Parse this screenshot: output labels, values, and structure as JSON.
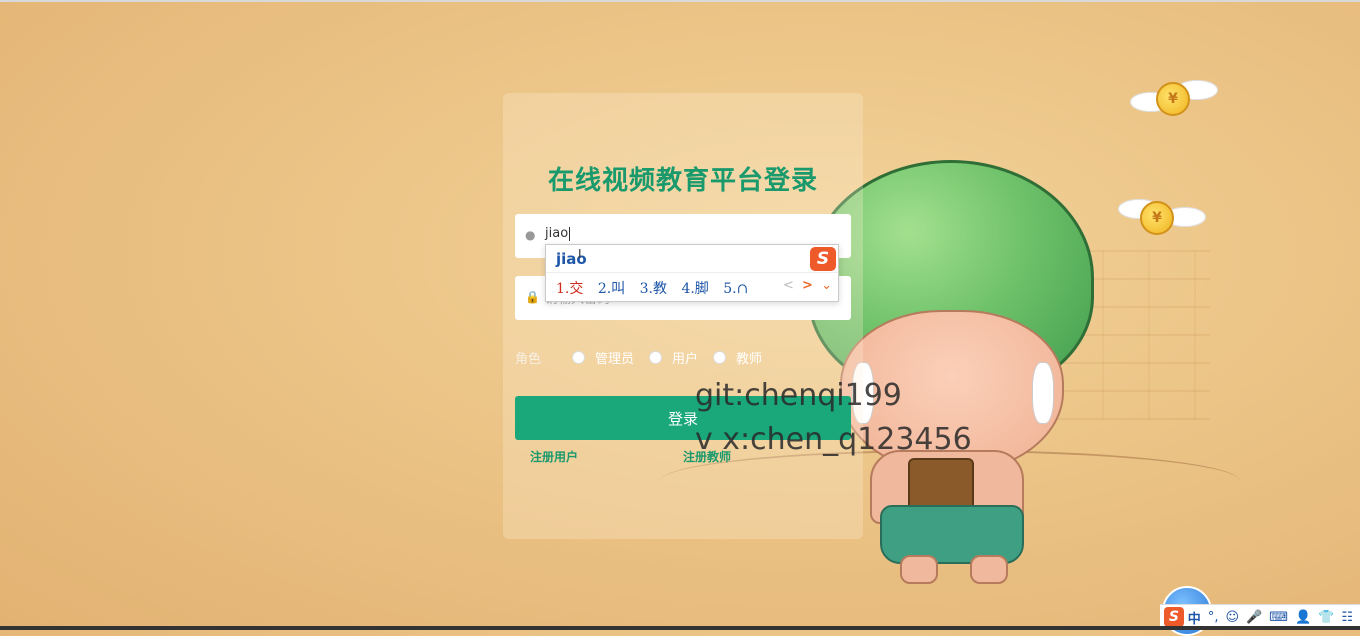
{
  "title": "在线视频教育平台登录",
  "username": {
    "value": "jiao",
    "icon": "user-icon"
  },
  "password": {
    "placeholder": "请输入密码",
    "icon": "lock-icon"
  },
  "role": {
    "label": "角色",
    "options": [
      "管理员",
      "用户",
      "教师"
    ]
  },
  "login_button": "登录",
  "links": {
    "register_user": "注册用户",
    "register_teacher": "注册教师"
  },
  "ime_popup": {
    "composition": "jiao",
    "logo": "S",
    "candidates": [
      "1.交",
      "2.叫",
      "3.教",
      "4.脚",
      "5.∩"
    ],
    "nav_prev": "<",
    "nav_next": ">",
    "nav_more": "⌄"
  },
  "watermark": {
    "line1": "git:chenqi199",
    "line2": "v x:chen_q123456"
  },
  "ime_toolbar": {
    "logo": "S",
    "lang": "中",
    "punct": "°,",
    "emoji": "☺",
    "mic": "🎤",
    "keyboard": "⌨",
    "user": "👤",
    "skin": "👕",
    "tools": "☷"
  },
  "colors": {
    "accent": "#1aa77a",
    "title": "#1a9a6c",
    "ime_orange": "#ef5a2b"
  }
}
